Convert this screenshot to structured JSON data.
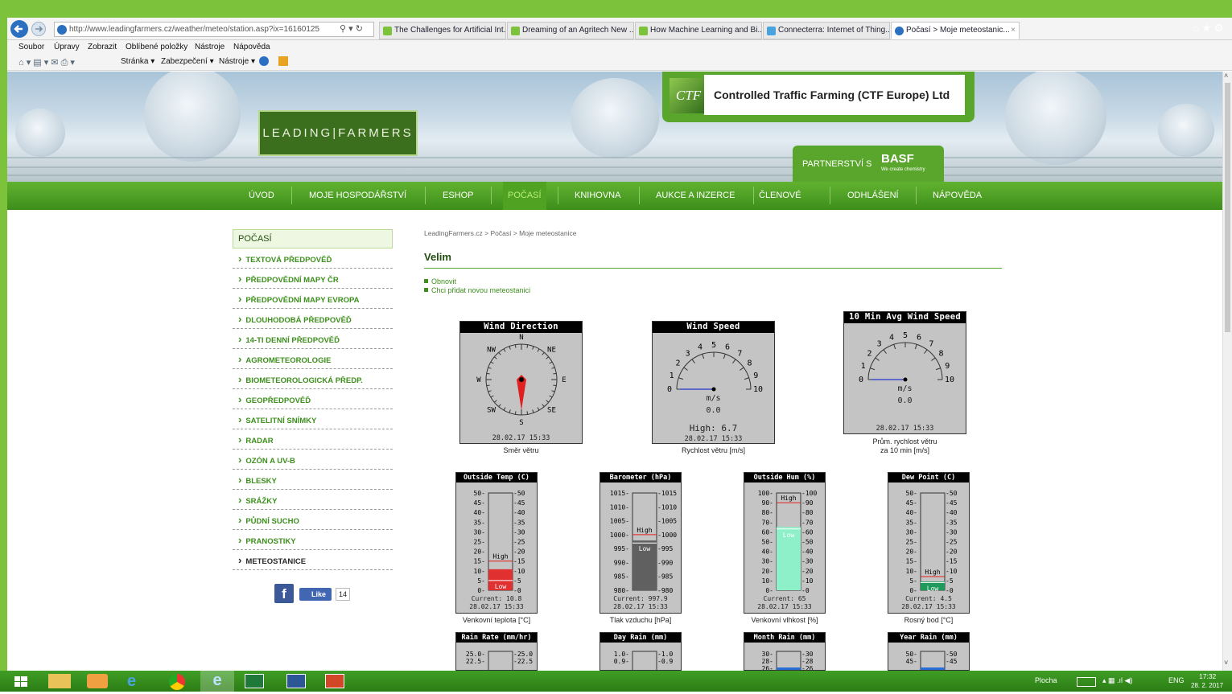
{
  "browser": {
    "address": "http://www.leadingfarmers.cz/weather/meteo/station.asp?ix=16160125",
    "tabs": [
      "The Challenges for Artificial Int...",
      "Dreaming of an Agritech New ...",
      "How Machine Learning and Bi...",
      "Connecterra: Internet of Thing...",
      "Počasí > Moje meteostanic..."
    ],
    "menu": [
      "Soubor",
      "Úpravy",
      "Zobrazit",
      "Oblíbené položky",
      "Nástroje",
      "Nápověda"
    ],
    "cmd": [
      "Stránka ▾",
      "Zabezpečení ▾",
      "Nástroje ▾"
    ]
  },
  "banner": {
    "logo": "LEADING|FARMERS",
    "ctf_logo": "CTF",
    "ctf_title": "Controlled Traffic Farming (CTF Europe) Ltd",
    "partner": "PARTNERSTVÍ S",
    "basf": "BASF",
    "basf_tag": "We create chemistry"
  },
  "nav": [
    "ÚVOD",
    "MOJE HOSPODÁŘSTVÍ",
    "ESHOP",
    "POČASÍ",
    "KNIHOVNA",
    "AUKCE A INZERCE",
    "ČLENOVÉ",
    "ODHLÁŠENÍ",
    "NÁPOVĚDA"
  ],
  "sidebar": {
    "title": "POČASÍ",
    "items": [
      "TEXTOVÁ PŘEDPOVĚĎ",
      "PŘEDPOVĚDNÍ MAPY ČR",
      "PŘEDPOVĚDNÍ MAPY EVROPA",
      "DLOUHODOBÁ PŘEDPOVĚĎ",
      "14-TI DENNÍ PŘEDPOVĚĎ",
      "AGROMETEOROLOGIE",
      "BIOMETEOROLOGICKÁ PŘEDP.",
      "GEOPŘEDPOVĚĎ",
      "SATELITNÍ SNÍMKY",
      "RADAR",
      "OZÓN A UV-B",
      "BLESKY",
      "SRÁŽKY",
      "PŮDNÍ SUCHO",
      "PRANOSTIKY",
      "METEOSTANICE"
    ],
    "fb_like": "Like",
    "fb_count": "14"
  },
  "main": {
    "breadcrumb": "LeadingFarmers.cz > Počasí > Moje meteostanice",
    "title": "Velim",
    "links": [
      "Obnovit",
      "Chci přidat novou meteostanici"
    ]
  },
  "gauges": {
    "wind_dir": {
      "title": "Wind Direction",
      "stamp": "28.02.17  15:33",
      "caption": "Směr větru",
      "dirs": [
        "N",
        "NE",
        "E",
        "SE",
        "S",
        "SW",
        "W",
        "NW"
      ],
      "degrees": 180
    },
    "wind_speed": {
      "title": "Wind Speed",
      "unit": "m/s",
      "value": "0.0",
      "high": "High: 6.7",
      "stamp": "28.02.17  15:33",
      "caption": "Rychlost větru [m/s]"
    },
    "wind_avg": {
      "title": "10 Min Avg Wind Speed",
      "unit": "m/s",
      "value": "0.0",
      "stamp": "28.02.17  15:33",
      "caption1": "Prům. rychlost větru",
      "caption2": "za 10 min [m/s]"
    },
    "scale_labels": [
      "0",
      "1",
      "2",
      "3",
      "4",
      "5",
      "6",
      "7",
      "8",
      "9",
      "10"
    ]
  },
  "bars": [
    {
      "title": "Outside Temp (C)",
      "current": "Current: 10.8",
      "stamp": "28.02.17 15:33",
      "caption": "Venkovní teplota [°C]",
      "ticks": [
        "50",
        "45",
        "40",
        "35",
        "30",
        "25",
        "20",
        "15",
        "10",
        "5",
        "0"
      ],
      "min": 0,
      "max": 50,
      "value": 10.8,
      "high": 15,
      "low": 5,
      "fill": "#e03030",
      "high_label": "High",
      "low_label": "Low"
    },
    {
      "title": "Barometer (hPa)",
      "current": "Current: 997.9",
      "stamp": "28.02.17 15:33",
      "caption": "Tlak vzduchu [hPa]",
      "ticks": [
        "1015",
        "1010",
        "1005",
        "1000",
        "995",
        "990",
        "985",
        "980"
      ],
      "min": 980,
      "max": 1015,
      "value": 997.9,
      "high": 1000,
      "low": 997,
      "fill": "#606060",
      "high_label": "High",
      "low_label": "Low"
    },
    {
      "title": "Outside Hum (%)",
      "current": "Current: 65",
      "stamp": "28.02.17 15:33",
      "caption": "Venkovní vlhkost [%]",
      "ticks": [
        "100",
        "90",
        "80",
        "70",
        "60",
        "50",
        "40",
        "30",
        "20",
        "10",
        "0"
      ],
      "min": 0,
      "max": 100,
      "value": 65,
      "high": 90,
      "low": 63,
      "fill": "#8ef0c8",
      "high_label": "High",
      "low_label": "Low"
    },
    {
      "title": "Dew Point (C)",
      "current": "Current: 4.5",
      "stamp": "28.02.17 15:33",
      "caption": "Rosný bod [°C]",
      "ticks": [
        "50",
        "45",
        "40",
        "35",
        "30",
        "25",
        "20",
        "15",
        "10",
        "5",
        "0"
      ],
      "min": 0,
      "max": 50,
      "value": 4.5,
      "high": 7,
      "low": 4,
      "fill": "#1f9a5b",
      "high_label": "High",
      "low_label": "Low"
    },
    {
      "title": "Rain Rate (mm/hr)",
      "ticks": [
        "25.0",
        "22.5"
      ]
    },
    {
      "title": "Day Rain (mm)",
      "ticks": [
        "1.0",
        "0.9"
      ]
    },
    {
      "title": "Month Rain (mm)",
      "ticks": [
        "30",
        "28",
        "26"
      ]
    },
    {
      "title": "Year Rain (mm)",
      "ticks": [
        "50",
        "45"
      ]
    }
  ],
  "taskbar": {
    "desktop": "Plocha",
    "lang": "ENG",
    "time": "17:32",
    "date": "28. 2. 2017"
  },
  "colors": {
    "brand": "#5aa62c",
    "nav_active": "#b8ee77",
    "link": "#3c8f1c"
  }
}
